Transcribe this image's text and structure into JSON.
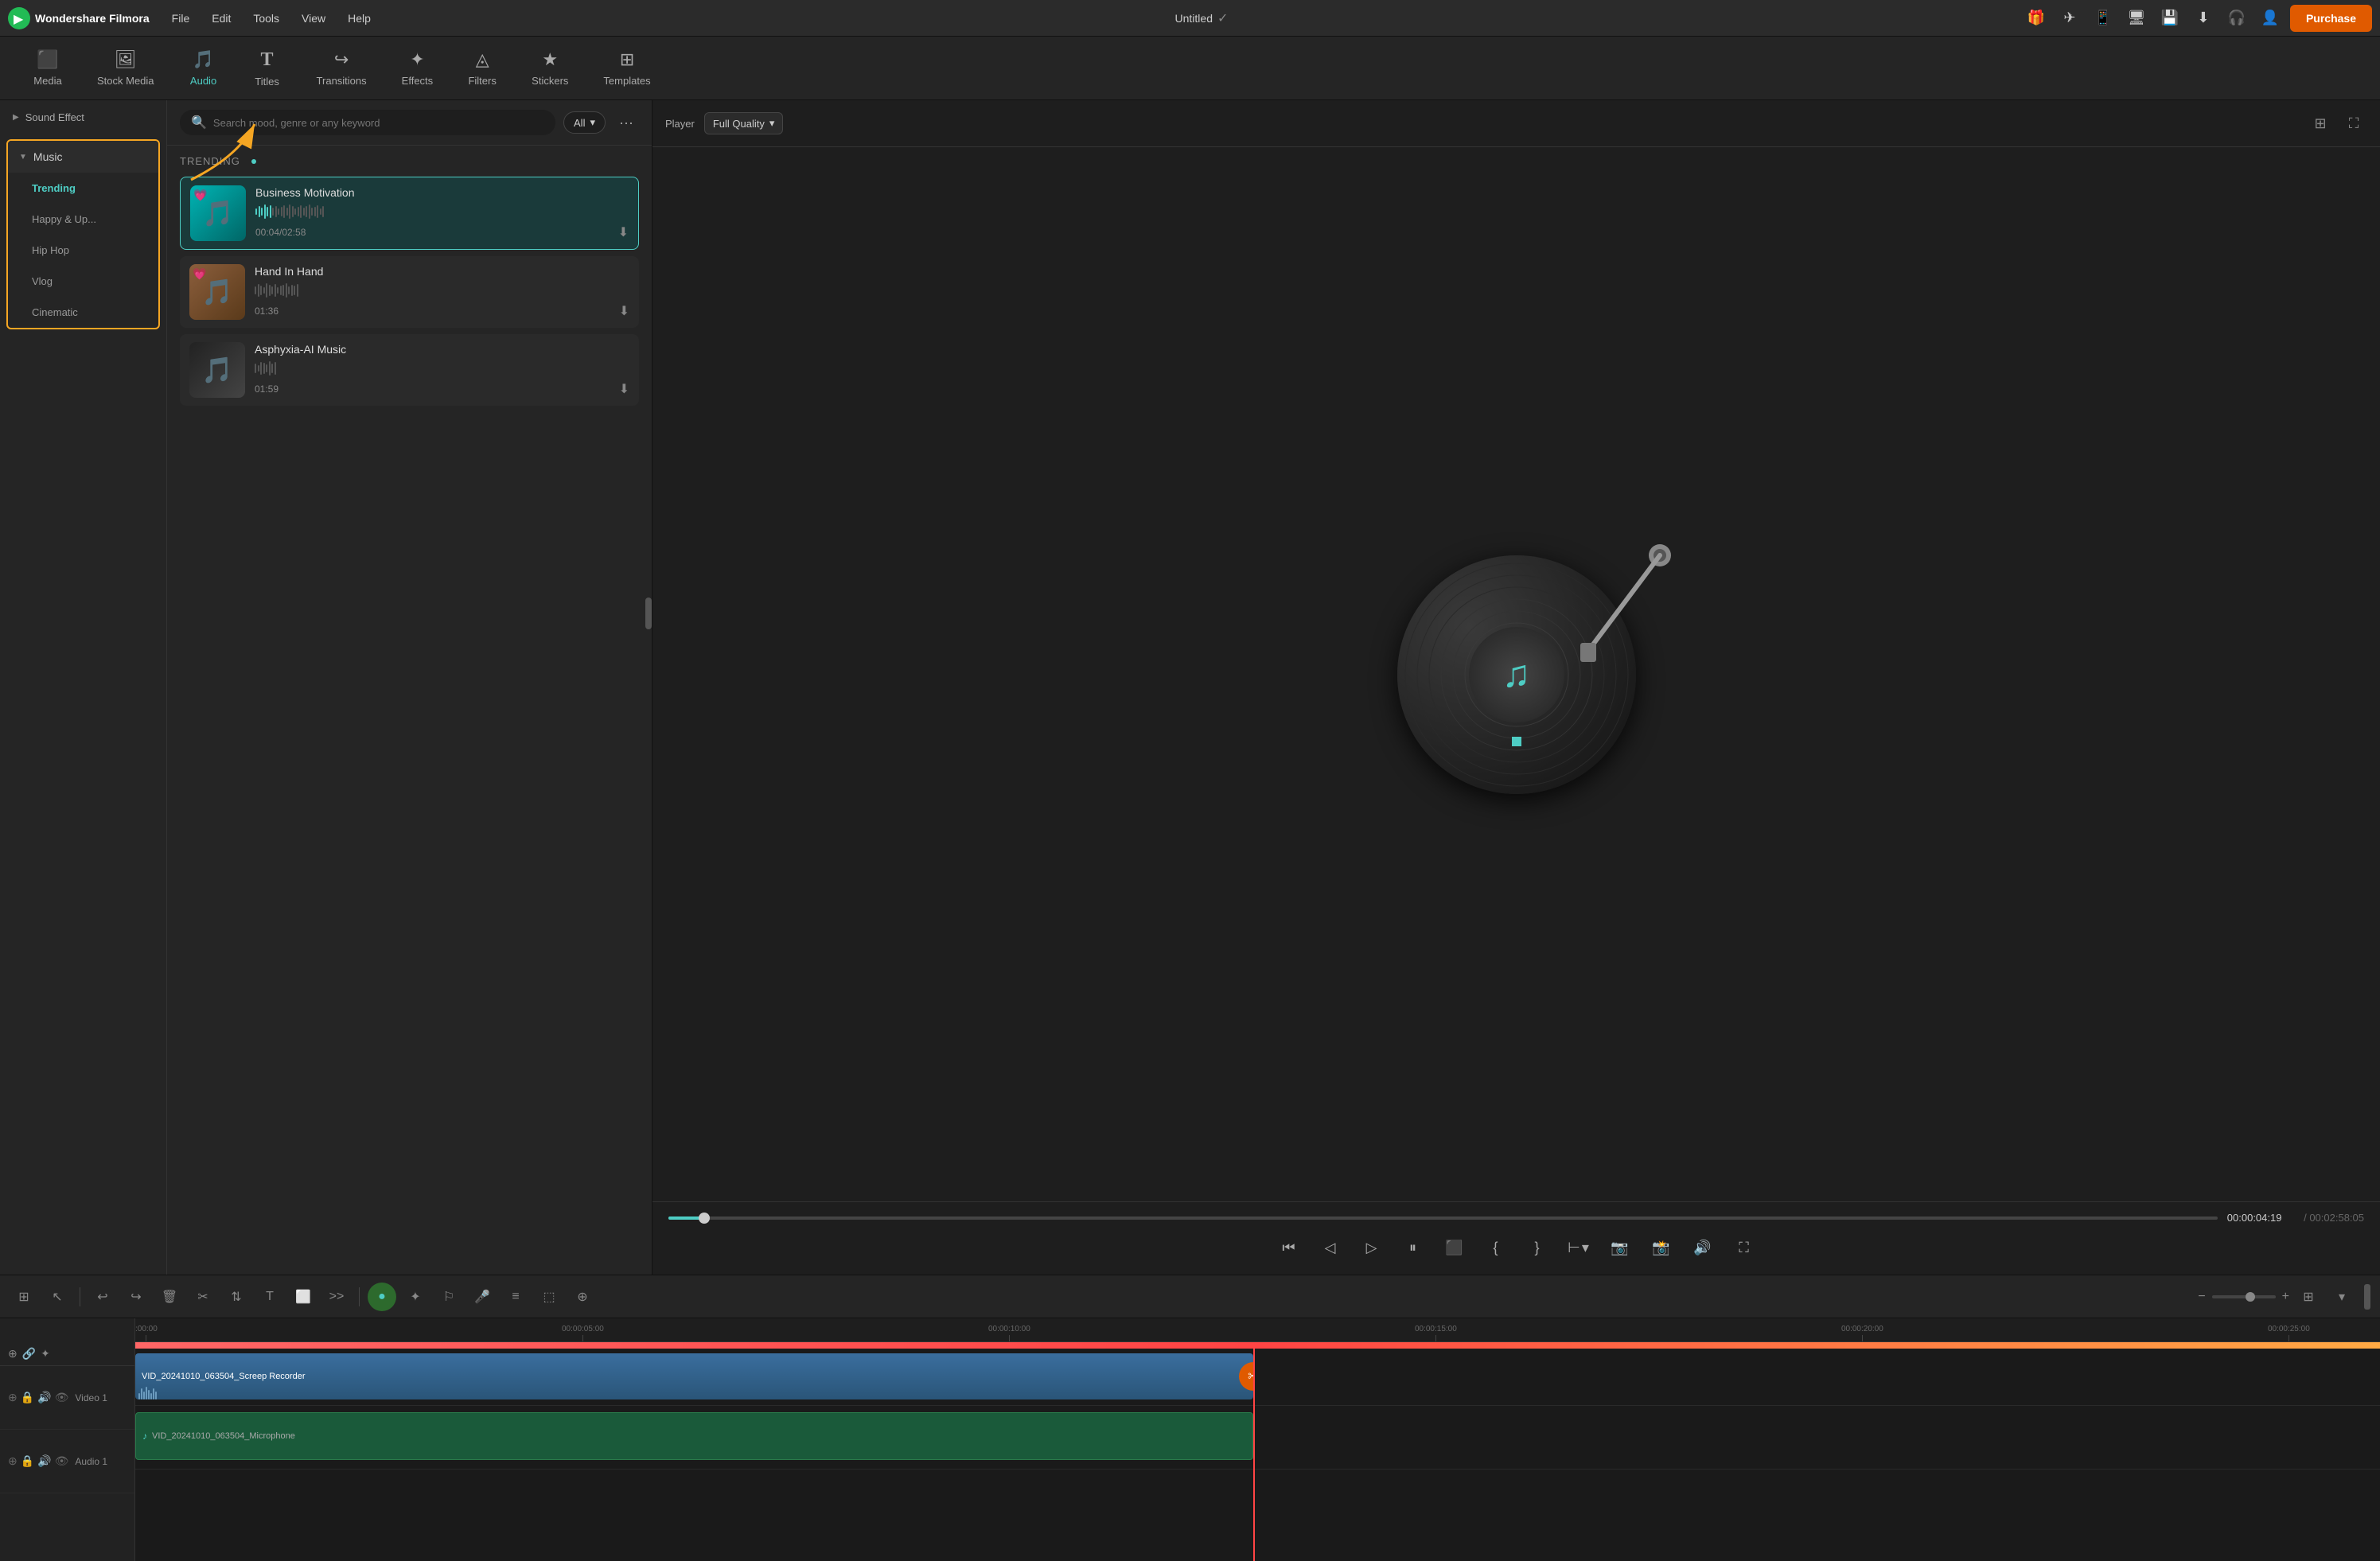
{
  "app": {
    "name": "Wondershare Filmora",
    "project_title": "Untitled"
  },
  "menu": {
    "items": [
      "File",
      "Edit",
      "Tools",
      "View",
      "Help"
    ]
  },
  "purchase_btn": "Purchase",
  "toolbar": {
    "items": [
      {
        "id": "media",
        "label": "Media",
        "icon": "🖥"
      },
      {
        "id": "stock",
        "label": "Stock Media",
        "icon": "📷"
      },
      {
        "id": "audio",
        "label": "Audio",
        "icon": "🎵"
      },
      {
        "id": "titles",
        "label": "Titles",
        "icon": "T"
      },
      {
        "id": "transitions",
        "label": "Transitions",
        "icon": "↪"
      },
      {
        "id": "effects",
        "label": "Effects",
        "icon": "✦"
      },
      {
        "id": "filters",
        "label": "Filters",
        "icon": "⬡"
      },
      {
        "id": "stickers",
        "label": "Stickers",
        "icon": "🌟"
      },
      {
        "id": "templates",
        "label": "Templates",
        "icon": "⊞"
      }
    ]
  },
  "sidebar": {
    "sound_effect_label": "Sound Effect",
    "music_label": "Music",
    "items": [
      {
        "id": "trending",
        "label": "Trending",
        "active": true
      },
      {
        "id": "happy",
        "label": "Happy & Up..."
      },
      {
        "id": "hiphop",
        "label": "Hip Hop"
      },
      {
        "id": "vlog",
        "label": "Vlog"
      },
      {
        "id": "cinematic",
        "label": "Cinematic"
      }
    ]
  },
  "search": {
    "placeholder": "Search mood, genre or any keyword",
    "filter_label": "All",
    "more_icon": "···"
  },
  "trending": {
    "title": "TRENDING",
    "dot": true,
    "songs": [
      {
        "id": "business",
        "title": "Business Motivation",
        "duration_current": "00:04",
        "duration_total": "02:58",
        "active": true,
        "has_heart": true,
        "thumb_style": "teal"
      },
      {
        "id": "hand",
        "title": "Hand In Hand",
        "duration_current": "",
        "duration_total": "01:36",
        "active": false,
        "has_heart": true,
        "thumb_style": "brown"
      },
      {
        "id": "asphyxia",
        "title": "Asphyxia-AI Music",
        "duration_current": "",
        "duration_total": "01:59",
        "active": false,
        "has_heart": false,
        "thumb_style": "dark"
      }
    ]
  },
  "player": {
    "label": "Player",
    "quality": "Full Quality",
    "time_current": "00:00:04:19",
    "time_total": "/ 00:02:58:05",
    "progress_percent": 2.3
  },
  "timeline": {
    "ruler_marks": [
      {
        "label": ":00:00",
        "pos_percent": 0
      },
      {
        "label": "00:00:05:00",
        "pos_percent": 19
      },
      {
        "label": "00:00:10:00",
        "pos_percent": 38
      },
      {
        "label": "00:00:15:00",
        "pos_percent": 57
      },
      {
        "label": "00:00:20:00",
        "pos_percent": 76
      },
      {
        "label": "00:00:25:0",
        "pos_percent": 95
      }
    ],
    "tracks": [
      {
        "id": "video1",
        "label": "Video 1",
        "type": "video",
        "clips": [
          {
            "label": "VID_20241010_063504_Screep Recorder",
            "left": 0,
            "width": 50
          }
        ]
      },
      {
        "id": "audio1",
        "label": "Audio 1",
        "type": "audio",
        "clips": [
          {
            "label": "VID_20241010_063504_Microphone",
            "left": 0,
            "width": 50
          }
        ]
      }
    ],
    "playhead_pos": "49.8%"
  }
}
